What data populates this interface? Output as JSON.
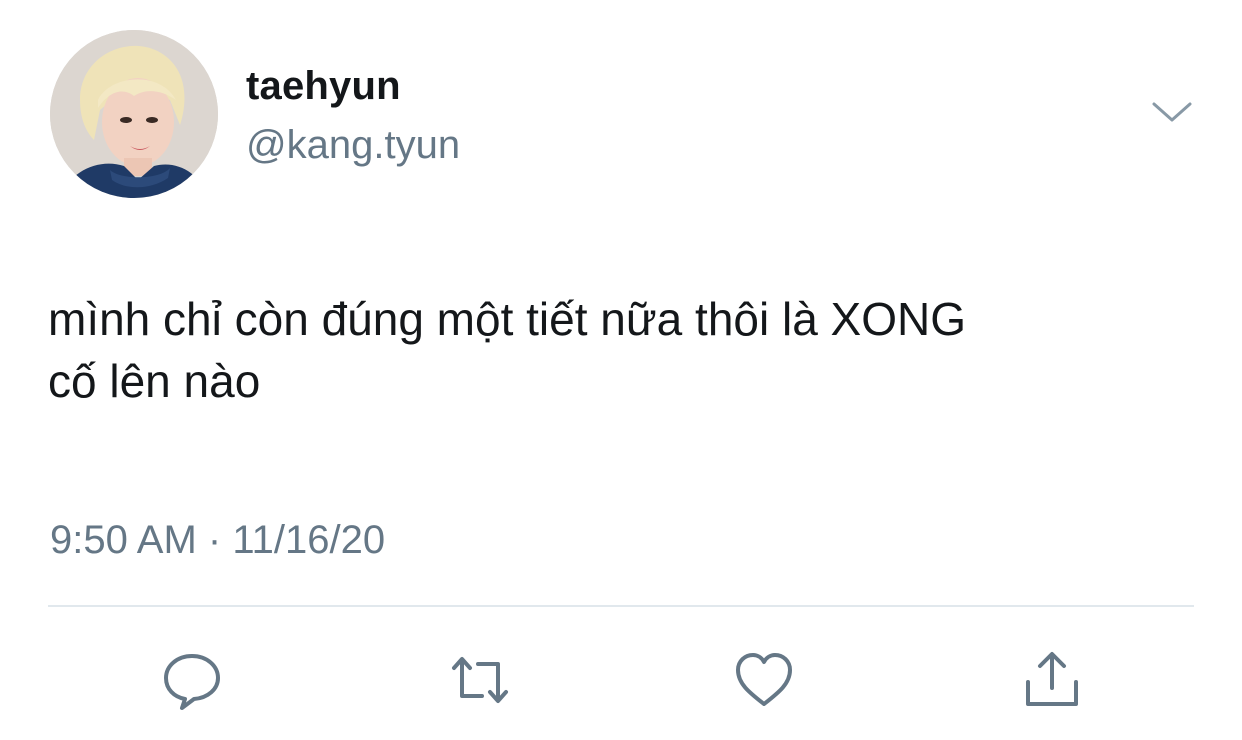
{
  "tweet": {
    "author": {
      "display_name": "taehyun",
      "handle": "@kang.tyun",
      "avatar_icon": "profile-photo"
    },
    "menu_icon": "chevron-down-icon",
    "text_lines": [
      "mình chỉ còn đúng một tiết nữa thôi là XONG",
      "cố lên nào"
    ],
    "meta": {
      "time": "9:50 AM",
      "separator": "·",
      "date": "11/16/20"
    },
    "actions": [
      {
        "name": "reply",
        "icon": "speech-bubble-icon"
      },
      {
        "name": "retweet",
        "icon": "retweet-icon"
      },
      {
        "name": "like",
        "icon": "heart-icon"
      },
      {
        "name": "share",
        "icon": "share-icon"
      }
    ]
  },
  "colors": {
    "text_primary": "#14171a",
    "text_secondary": "#657786",
    "icon": "#657786",
    "divider": "#e1e8ed",
    "avatar_sweater": "#1f3a66"
  }
}
